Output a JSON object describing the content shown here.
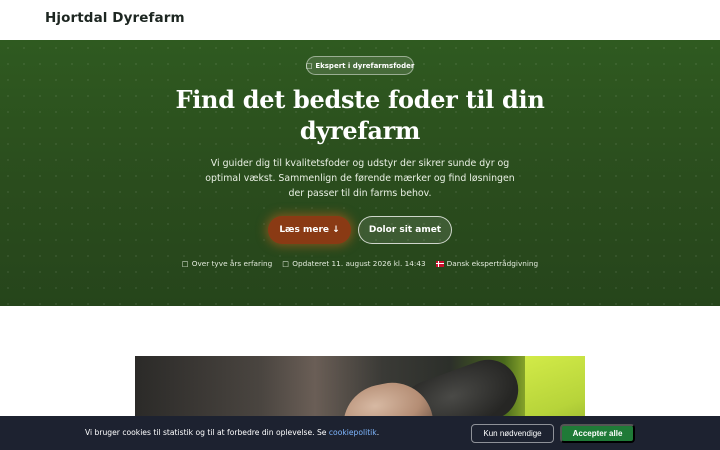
{
  "header": {
    "brand": "Hjortdal Dyrefarm"
  },
  "hero": {
    "badge_icon": "□",
    "badge_label": "Ekspert i dyrefarmsfoder",
    "title": "Find det bedste foder til din dyrefarm",
    "description": "Vi guider dig til kvalitetsfoder og udstyr der sikrer sunde dyr og optimal vækst. Sammenlign de førende mærker og find løsningen der passer til din farms behov.",
    "primary_button": "Læs mere ↓",
    "secondary_button": "Dolor sit amet",
    "meta": [
      {
        "icon": "□",
        "text": "Over tyve års erfaring"
      },
      {
        "icon": "□",
        "text": "Opdateret 11. august 2026 kl. 14:43"
      },
      {
        "icon": "danish-flag",
        "text": "Dansk ekspertrådgivning"
      }
    ]
  },
  "cookie": {
    "text": "Vi bruger cookies til statistik og til at forbedre din oplevelse. Se ",
    "link": "cookiepolitik",
    "suffix": ".",
    "necessary_button": "Kun nødvendige",
    "accept_button": "Accepter alle"
  },
  "colors": {
    "hero_green": "#2c4e1f",
    "primary_button": "#8a3a14",
    "accept_button": "#1f7a37",
    "cookie_bar": "#1d2230",
    "link": "#7eb6ff"
  }
}
